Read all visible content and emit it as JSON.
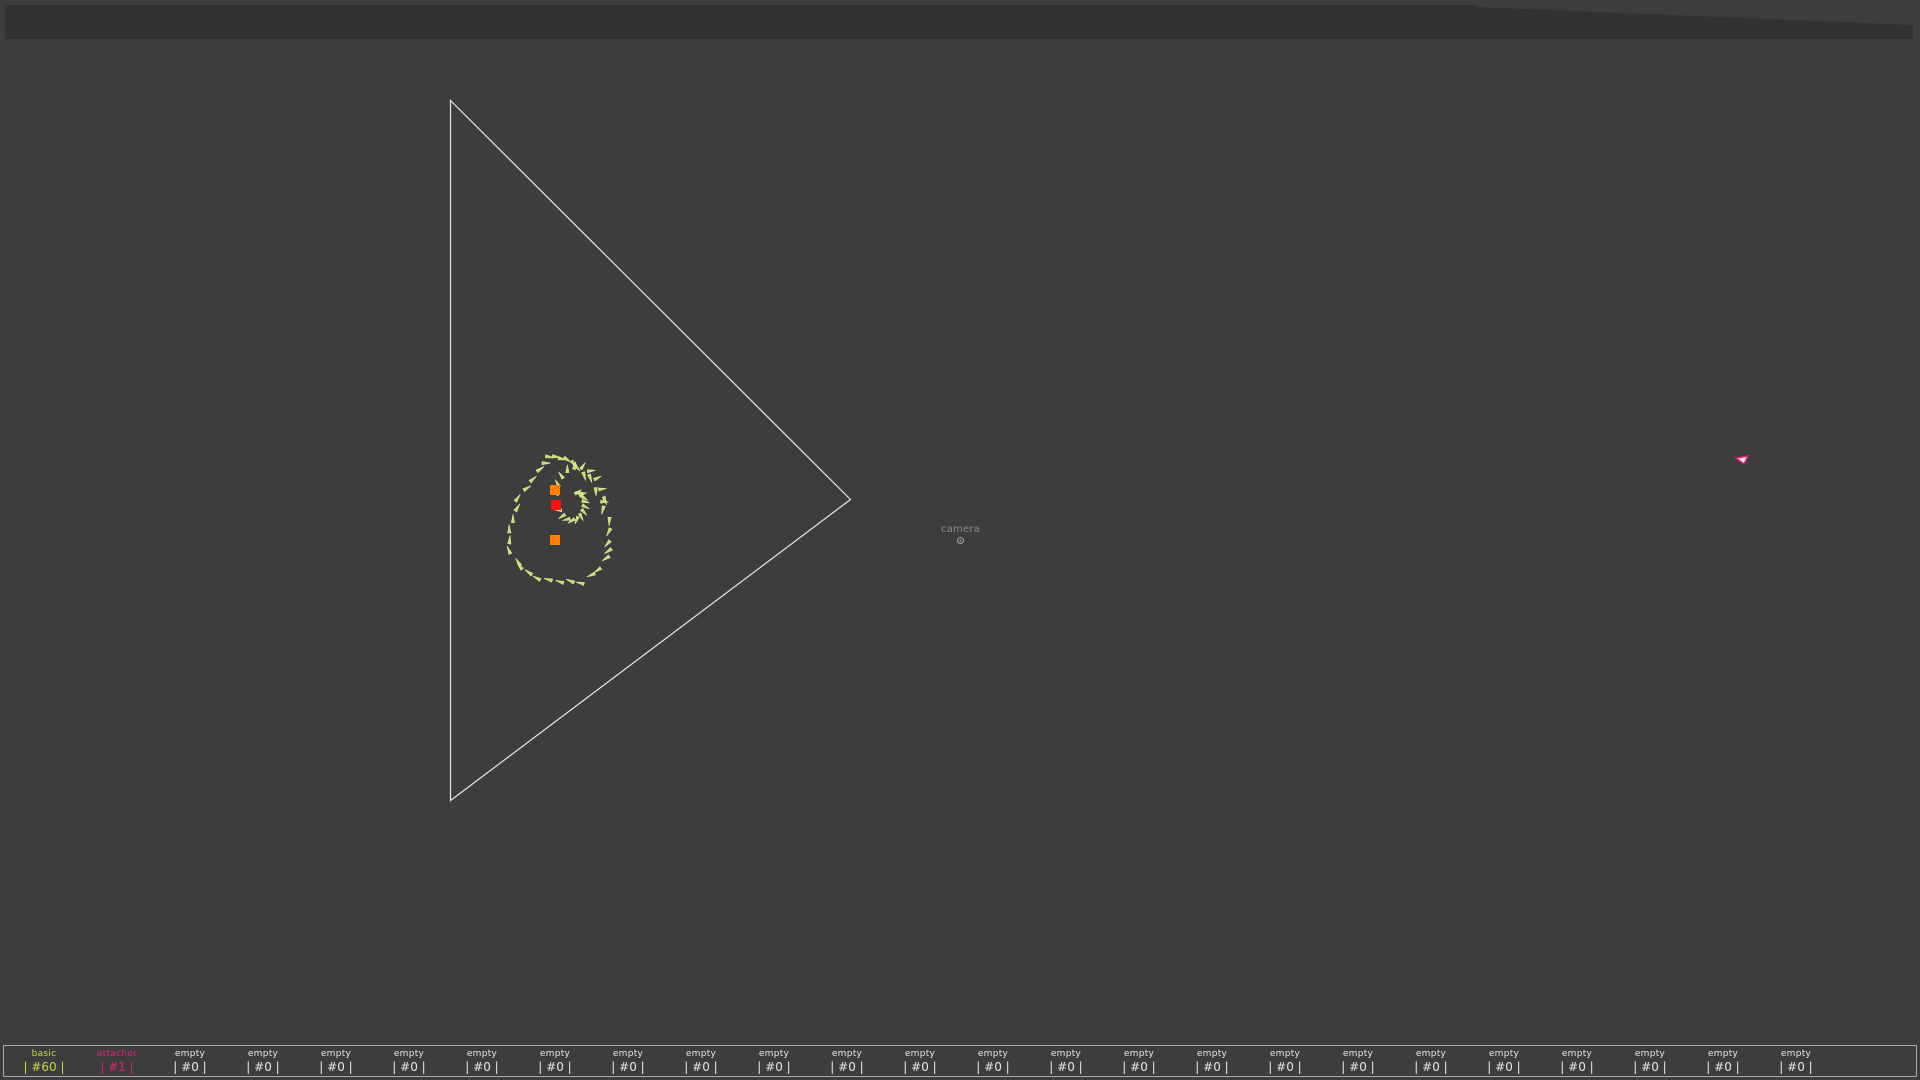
{
  "colors": {
    "background": "#3d3d3d",
    "top_bar": "#323232",
    "triangle_stroke": "#e8e8e8",
    "particle": "#c8d86a",
    "particle_edge": "#e6ee9a",
    "orange_marker": "#ff7f00",
    "red_marker": "#ff1010",
    "attacher": "#e0207a",
    "basic": "#c9d84a",
    "camera_label": "#8a8a8a",
    "slot_text": "#e6e6e6"
  },
  "viewport": {
    "camera_label": "camera",
    "camera_icon": "camera-target-icon",
    "cursor_icon": "pink-triangle-cursor-icon"
  },
  "slots": [
    {
      "name": "basic",
      "count": "#60",
      "color": "#c9d84a"
    },
    {
      "name": "attacher",
      "count": "#1",
      "color": "#e0207a"
    },
    {
      "name": "empty",
      "count": "#0",
      "color": "#e6e6e6"
    },
    {
      "name": "empty",
      "count": "#0",
      "color": "#e6e6e6"
    },
    {
      "name": "empty",
      "count": "#0",
      "color": "#e6e6e6"
    },
    {
      "name": "empty",
      "count": "#0",
      "color": "#e6e6e6"
    },
    {
      "name": "empty",
      "count": "#0",
      "color": "#e6e6e6"
    },
    {
      "name": "empty",
      "count": "#0",
      "color": "#e6e6e6"
    },
    {
      "name": "empty",
      "count": "#0",
      "color": "#e6e6e6"
    },
    {
      "name": "empty",
      "count": "#0",
      "color": "#e6e6e6"
    },
    {
      "name": "empty",
      "count": "#0",
      "color": "#e6e6e6"
    },
    {
      "name": "empty",
      "count": "#0",
      "color": "#e6e6e6"
    },
    {
      "name": "empty",
      "count": "#0",
      "color": "#e6e6e6"
    },
    {
      "name": "empty",
      "count": "#0",
      "color": "#e6e6e6"
    },
    {
      "name": "empty",
      "count": "#0",
      "color": "#e6e6e6"
    },
    {
      "name": "empty",
      "count": "#0",
      "color": "#e6e6e6"
    },
    {
      "name": "empty",
      "count": "#0",
      "color": "#e6e6e6"
    },
    {
      "name": "empty",
      "count": "#0",
      "color": "#e6e6e6"
    },
    {
      "name": "empty",
      "count": "#0",
      "color": "#e6e6e6"
    },
    {
      "name": "empty",
      "count": "#0",
      "color": "#e6e6e6"
    },
    {
      "name": "empty",
      "count": "#0",
      "color": "#e6e6e6"
    },
    {
      "name": "empty",
      "count": "#0",
      "color": "#e6e6e6"
    },
    {
      "name": "empty",
      "count": "#0",
      "color": "#e6e6e6"
    },
    {
      "name": "empty",
      "count": "#0",
      "color": "#e6e6e6"
    },
    {
      "name": "empty",
      "count": "#0",
      "color": "#e6e6e6"
    }
  ]
}
